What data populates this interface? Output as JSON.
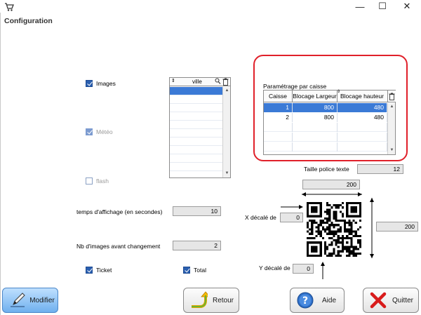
{
  "window": {
    "title": "Configuration",
    "minimize": "—",
    "maximize": "☐",
    "close": "✕"
  },
  "options": {
    "images": {
      "label": "Images",
      "checked": true
    },
    "meteo": {
      "label": "Météo",
      "checked": true,
      "enabled": false
    },
    "flash": {
      "label": "flash",
      "checked": false,
      "enabled": false
    },
    "ticket": {
      "label": "Ticket",
      "checked": true
    },
    "total": {
      "label": "Total",
      "checked": true
    }
  },
  "ville_grid": {
    "header": "ville",
    "rows": []
  },
  "fields": {
    "temps_affichage": {
      "label": "temps d'affichage (en secondes)",
      "value": "10"
    },
    "nb_images": {
      "label": "Nb d'images avant changement",
      "value": "2"
    },
    "taille_police": {
      "label": "Taille police texte",
      "value": "12"
    },
    "qr_width": {
      "value": "200"
    },
    "qr_height": {
      "value": "200"
    },
    "x_decale": {
      "label": "X décalé de",
      "value": "0"
    },
    "y_decale": {
      "label": "Y décalé de",
      "value": "0"
    }
  },
  "parametrage": {
    "title": "Paramétrage par caisse",
    "columns": [
      "Caisse",
      "Blocage Largeur",
      "Blocage hauteur"
    ],
    "rows": [
      {
        "caisse": "1",
        "largeur": "800",
        "hauteur": "480"
      },
      {
        "caisse": "2",
        "largeur": "800",
        "hauteur": "480"
      }
    ]
  },
  "buttons": {
    "modifier": "Modifier",
    "retour": "Retour",
    "aide": "Aide",
    "quitter": "Quitter"
  },
  "colors": {
    "accent": "#3b7ad6",
    "highlight_frame": "#e0202a"
  }
}
